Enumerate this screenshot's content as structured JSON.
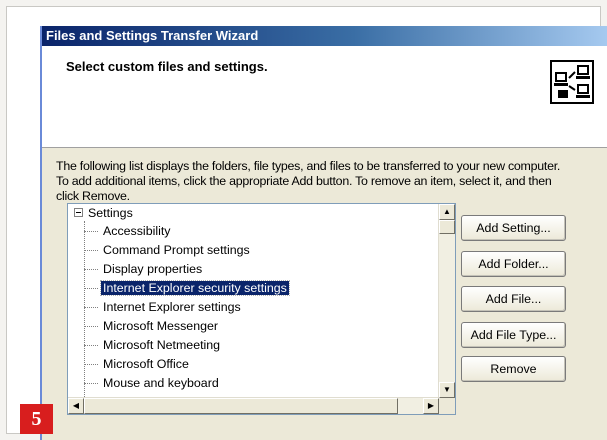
{
  "window": {
    "title": "Files and Settings Transfer Wizard"
  },
  "header": {
    "title": "Select custom files and settings.",
    "icon": "transfer-wizard-icon"
  },
  "description": {
    "line1": "The following list displays the folders, file types, and files to be transferred to your new computer.",
    "line2": "To add additional items, click the appropriate Add button. To remove an item, select it, and then",
    "line3": "click Remove."
  },
  "tree": {
    "root_label": "Settings",
    "expanded": true,
    "items": [
      {
        "label": "Accessibility",
        "selected": false
      },
      {
        "label": "Command Prompt settings",
        "selected": false
      },
      {
        "label": "Display properties",
        "selected": false
      },
      {
        "label": "Internet Explorer security settings",
        "selected": true
      },
      {
        "label": "Internet Explorer settings",
        "selected": false
      },
      {
        "label": "Microsoft Messenger",
        "selected": false
      },
      {
        "label": "Microsoft Netmeeting",
        "selected": false
      },
      {
        "label": "Microsoft Office",
        "selected": false
      },
      {
        "label": "Mouse and keyboard",
        "selected": false
      }
    ]
  },
  "buttons": {
    "add_setting": "Add Setting...",
    "add_folder": "Add Folder...",
    "add_file": "Add File...",
    "add_file_type": "Add File Type...",
    "remove": "Remove"
  },
  "badge": {
    "number": "5",
    "color": "#d81e1e"
  },
  "colors": {
    "titlebar_start": "#0a246a",
    "selection": "#0a246a",
    "dialog_bg": "#ece9d8"
  }
}
